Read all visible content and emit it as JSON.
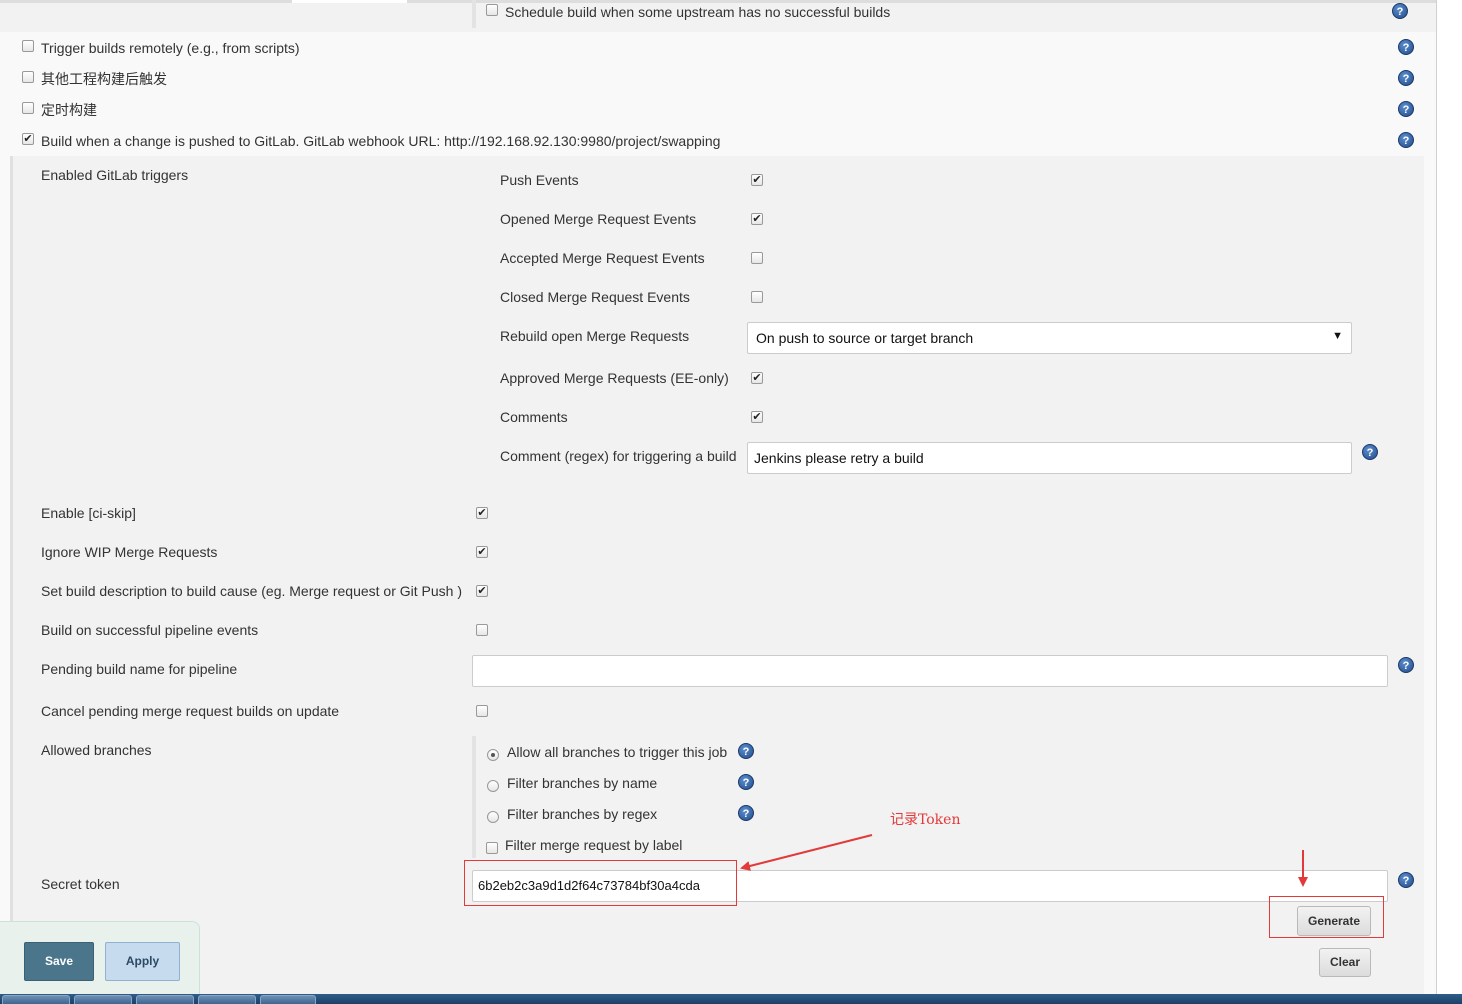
{
  "upstream": {
    "schedule_label": "Schedule build when some upstream has no successful builds",
    "checked": false
  },
  "triggers": [
    {
      "label": "Trigger builds remotely (e.g., from scripts)",
      "checked": false
    },
    {
      "label": "其他工程构建后触发",
      "checked": false
    },
    {
      "label": "定时构建",
      "checked": false
    },
    {
      "label": "Build when a change is pushed to GitLab. GitLab webhook URL: http://192.168.92.130:9980/project/swapping",
      "checked": true
    }
  ],
  "gitlab": {
    "enabled_triggers_label": "Enabled GitLab triggers",
    "events": [
      {
        "label": "Push Events",
        "checked": true
      },
      {
        "label": "Opened Merge Request Events",
        "checked": true
      },
      {
        "label": "Accepted Merge Request Events",
        "checked": false
      },
      {
        "label": "Closed Merge Request Events",
        "checked": false
      }
    ],
    "rebuild_label": "Rebuild open Merge Requests",
    "rebuild_value": "On push to source or target branch",
    "approved_label": "Approved Merge Requests (EE-only)",
    "approved_checked": true,
    "comments_label": "Comments",
    "comments_checked": true,
    "comment_regex_label": "Comment (regex) for triggering a build",
    "comment_regex_value": "Jenkins please retry a build"
  },
  "options": {
    "ci_skip_label": "Enable [ci-skip]",
    "ci_skip_checked": true,
    "ignore_wip_label": "Ignore WIP Merge Requests",
    "ignore_wip_checked": true,
    "set_desc_label": "Set build description to build cause (eg. Merge request or Git Push )",
    "set_desc_checked": true,
    "pipeline_label": "Build on successful pipeline events",
    "pipeline_checked": false,
    "pending_name_label": "Pending build name for pipeline",
    "pending_name_value": "",
    "cancel_pending_label": "Cancel pending merge request builds on update",
    "cancel_pending_checked": false
  },
  "branches": {
    "label": "Allowed branches",
    "options": [
      {
        "label": "Allow all branches to trigger this job",
        "selected": true
      },
      {
        "label": "Filter branches by name",
        "selected": false
      },
      {
        "label": "Filter branches by regex",
        "selected": false
      }
    ],
    "filter_label_text": "Filter merge request by label",
    "filter_label_checked": false
  },
  "secret": {
    "label": "Secret token",
    "value": "6b2eb2c3a9d1d2f64c73784bf30a4cda",
    "generate_label": "Generate",
    "clear_label": "Clear"
  },
  "annotation": {
    "text": "记录Token",
    "color": "#e23a3a"
  },
  "footer": {
    "save_label": "Save",
    "apply_label": "Apply"
  },
  "colors": {
    "save_bg": "#4b758b",
    "apply_bg": "#c6dbee",
    "help_icon": "#204a87"
  },
  "glyphs": {
    "check": "✔",
    "help": "?",
    "caret": "▼"
  }
}
